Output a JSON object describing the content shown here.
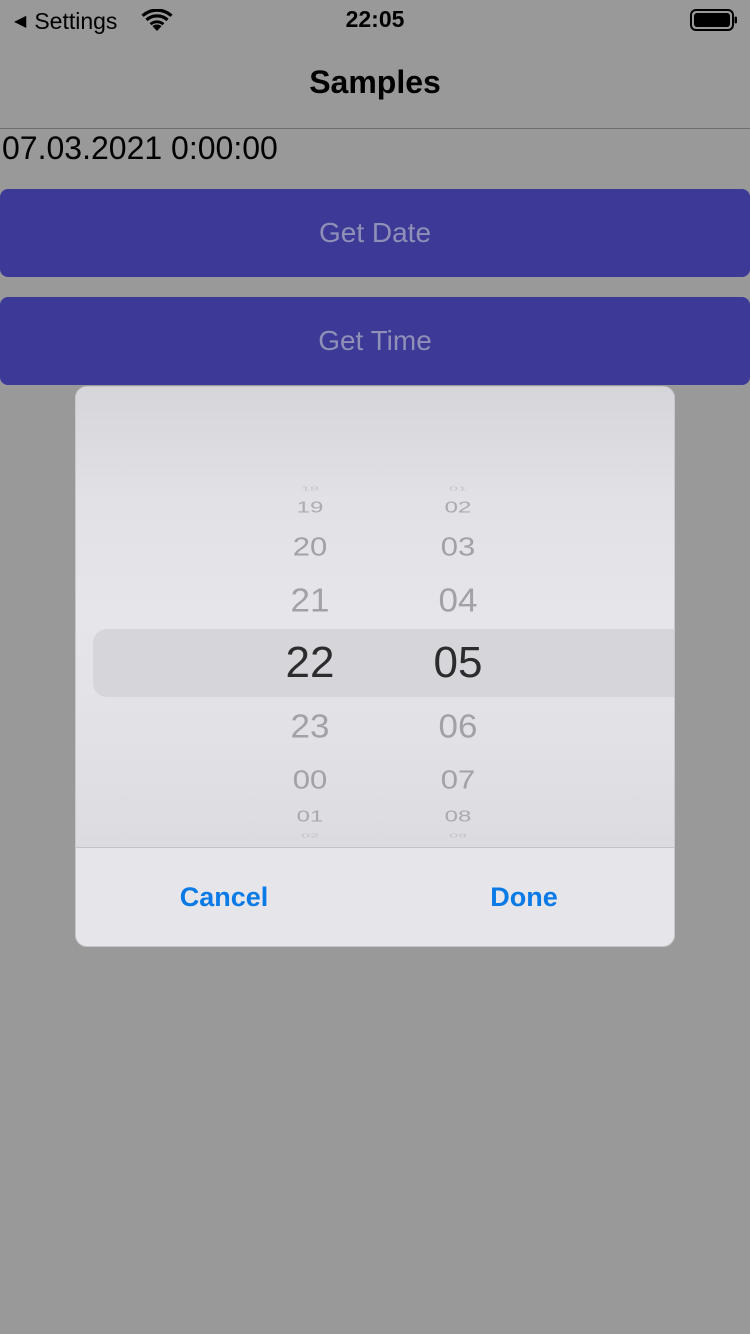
{
  "status_bar": {
    "back_app_label": "Settings",
    "back_arrow_icon": "back-triangle-icon",
    "wifi_icon": "wifi-icon",
    "time": "22:05",
    "battery_icon": "battery-icon"
  },
  "nav": {
    "title": "Samples"
  },
  "main": {
    "date_value": "07.03.2021 0:00:00",
    "get_date_label": "Get Date",
    "get_time_label": "Get Time",
    "button_color": "#3c3a96"
  },
  "time_picker": {
    "hours": [
      "18",
      "19",
      "20",
      "21",
      "22",
      "23",
      "00",
      "01",
      "02"
    ],
    "minutes": [
      "01",
      "02",
      "03",
      "04",
      "05",
      "06",
      "07",
      "08",
      "09"
    ],
    "selected_hour": "22",
    "selected_minute": "05",
    "cancel_label": "Cancel",
    "done_label": "Done",
    "accent_color": "#0a7ae6"
  }
}
